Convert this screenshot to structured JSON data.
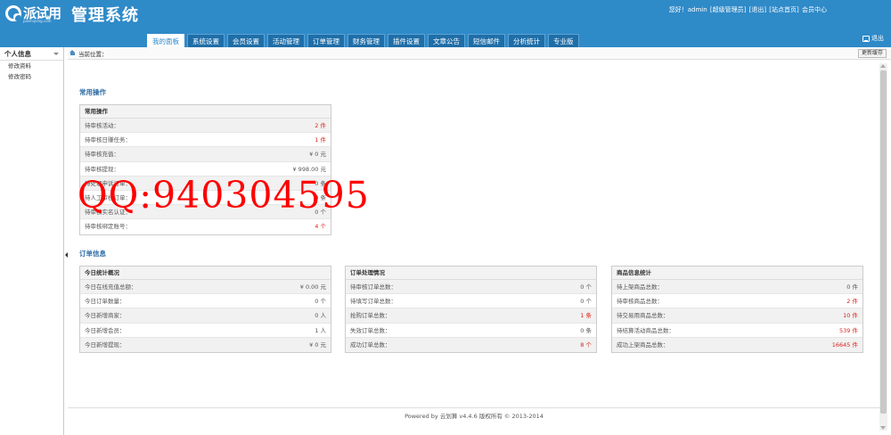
{
  "brand": {
    "logo_text": "派试用",
    "logo_sub": "paishiyong.com",
    "title": "管理系统"
  },
  "user_bar": {
    "greeting": "您好！admin",
    "role": "[超级管理员]",
    "logout": "[退出]",
    "site_home": "[站点首页]",
    "member_center": "会员中心"
  },
  "nav": [
    {
      "label": "我的面板"
    },
    {
      "label": "系统设置"
    },
    {
      "label": "会员设置"
    },
    {
      "label": "活动管理"
    },
    {
      "label": "订单管理"
    },
    {
      "label": "财务管理"
    },
    {
      "label": "插件设置"
    },
    {
      "label": "文章公告"
    },
    {
      "label": "短信邮件"
    },
    {
      "label": "分析统计"
    },
    {
      "label": "专业版"
    }
  ],
  "logout_label": "退出",
  "sidebar": {
    "title": "个人信息",
    "items": [
      {
        "label": "修改资料"
      },
      {
        "label": "修改密码"
      }
    ]
  },
  "breadcrumb": {
    "label": "当前位置："
  },
  "refresh_label": "更新缓存",
  "sections": {
    "common": "常用操作",
    "orders": "订单信息"
  },
  "common_panel": {
    "title": "常用操作",
    "rows": [
      {
        "label": "待审核活动：",
        "value": "2 件",
        "highlight": true
      },
      {
        "label": "待审核日赚任务：",
        "value": "1 件",
        "highlight": true
      },
      {
        "label": "待审核充值：",
        "value": "¥ 0 元",
        "highlight": false
      },
      {
        "label": "待审核提现：",
        "value": "¥ 998.00 元",
        "highlight": false
      },
      {
        "label": "待处理申诉订单：",
        "value": "0 条",
        "highlight": false
      },
      {
        "label": "待人工审核订单：",
        "value": "0 条",
        "highlight": false
      },
      {
        "label": "待审核实名认证：",
        "value": "0 个",
        "highlight": false
      },
      {
        "label": "待审核绑定账号：",
        "value": "4 个",
        "highlight": true
      }
    ]
  },
  "stats_panel": {
    "title": "今日统计概况",
    "rows": [
      {
        "label": "今日在线充值总额：",
        "value": "¥ 0.00 元",
        "highlight": false
      },
      {
        "label": "今日订单数量：",
        "value": "0 个",
        "highlight": false
      },
      {
        "label": "今日新增商家：",
        "value": "0 人",
        "highlight": false
      },
      {
        "label": "今日新增会员：",
        "value": "1 人",
        "highlight": false
      },
      {
        "label": "今日新增提现：",
        "value": "¥ 0 元",
        "highlight": false
      }
    ]
  },
  "order_panel": {
    "title": "订单处理情况",
    "rows": [
      {
        "label": "待审核订单总数：",
        "value": "0 个",
        "highlight": false
      },
      {
        "label": "待填写订单总数：",
        "value": "0 个",
        "highlight": false
      },
      {
        "label": "抢购订单总数：",
        "value": "1 条",
        "highlight": true
      },
      {
        "label": "失效订单总数：",
        "value": "0 条",
        "highlight": false
      },
      {
        "label": "成功订单总数：",
        "value": "8 个",
        "highlight": true
      }
    ]
  },
  "goods_panel": {
    "title": "商品信息统计",
    "rows": [
      {
        "label": "待上架商品总数：",
        "value": "0 件",
        "highlight": false
      },
      {
        "label": "待审核商品总数：",
        "value": "2 件",
        "highlight": true
      },
      {
        "label": "待交易用商品总数：",
        "value": "10 件",
        "highlight": true
      },
      {
        "label": "待结算活动商品总数：",
        "value": "539 件",
        "highlight": true
      },
      {
        "label": "成功上架商品总数：",
        "value": "16645 件",
        "highlight": true
      }
    ]
  },
  "footer": "Powered by 云划算 v4.4.6 版权所有 © 2013-2014",
  "watermark": "QQ:940304595",
  "colors": {
    "header": "#2f8ac8",
    "accent_red": "#d9261c",
    "section_title": "#2f6da6"
  }
}
